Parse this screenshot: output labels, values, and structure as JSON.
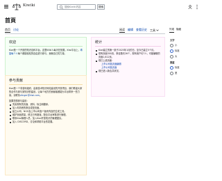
{
  "header": {
    "wordmark": "Kiwiki",
    "search_placeholder": "搜索Kiwiki内容",
    "search_button": "搜索",
    "icons": [
      "menu-icon",
      "logo-icon",
      "search-icon",
      "user-icon",
      "more-icon"
    ]
  },
  "page": {
    "title": "首頁",
    "tabs_left": [
      "首页",
      "讨论"
    ],
    "tabs_right": [
      "阅读",
      "编辑",
      "查看历史"
    ],
    "tools_label": "工具"
  },
  "sidebar": {
    "tabs": [
      "外观",
      "隐藏"
    ],
    "text_heading": "文字",
    "text_options": [
      {
        "label": "小",
        "selected": false
      },
      {
        "label": "标准",
        "selected": true
      },
      {
        "label": "大",
        "selected": false
      }
    ],
    "width_heading": "宽度",
    "width_options": [
      {
        "label": "标准",
        "selected": true
      },
      {
        "label": "宽",
        "selected": false
      }
    ]
  },
  "welcome": {
    "title": "欢迎",
    "text_prefix": "Kiwi是一个开放的知识百科平台。这里KiWi人每天在拓展，Kiwi平台上，",
    "link": "希望每个人",
    "text_suffix": "每个都能轻松的自由进行参与，贡献自己的力量。"
  },
  "stats": {
    "title": "统计",
    "items": [
      {
        "text": "Kiwi建立的第一篇于2025年1月的日，至今已建立5个月。"
      },
      {
        "text": "现有页面300页，条目数约26个，现有用户约7人，可被编辑的页面1,612页。"
      },
      {
        "text": "现已上线页面："
      },
      {
        "text": "上市公司各页面编辑"
      },
      {
        "text": "上市公司各页面"
      },
      {
        "text": "现已进入新合并状况。"
      }
    ]
  },
  "contribute": {
    "title": "参与贡献",
    "text_prefix": "Kiwi是一个非营利组织，由新技术知识网站建设的开放项目，我们希望大家的合作与参与到知识的建设，让每个地方的贡献者都能为平台带来一些力量。请联系",
    "link": "zlinger@kiwi.com",
    "text_suffix": "。",
    "list_heading": "如果您想参与建设：",
    "items": [
      {
        "text": "完善现有的页面、资料、标注和翻译。"
      },
      {
        "text": "加入你熟悉的条目或是页面。"
      },
      {
        "text": "建立公司、NGO及上市公司各个板块内容的生成工具。"
      },
      {
        "text": "维护页面质量，修正已有错误，配合平台审核进行管理。"
      },
      {
        "text": "联系Kiwi管理人员，加入Kiwi开放知识的管理团队。"
      },
      {
        "text": "加入 DISCORD，讨论和帮助平台的发展。"
      }
    ]
  },
  "colors": {
    "link": "#0645ad",
    "welcome_bg": "#f6fff6",
    "stats_bg": "#fff7fd",
    "contribute_bg": "#fffbf0",
    "accent": "#3366cc"
  }
}
